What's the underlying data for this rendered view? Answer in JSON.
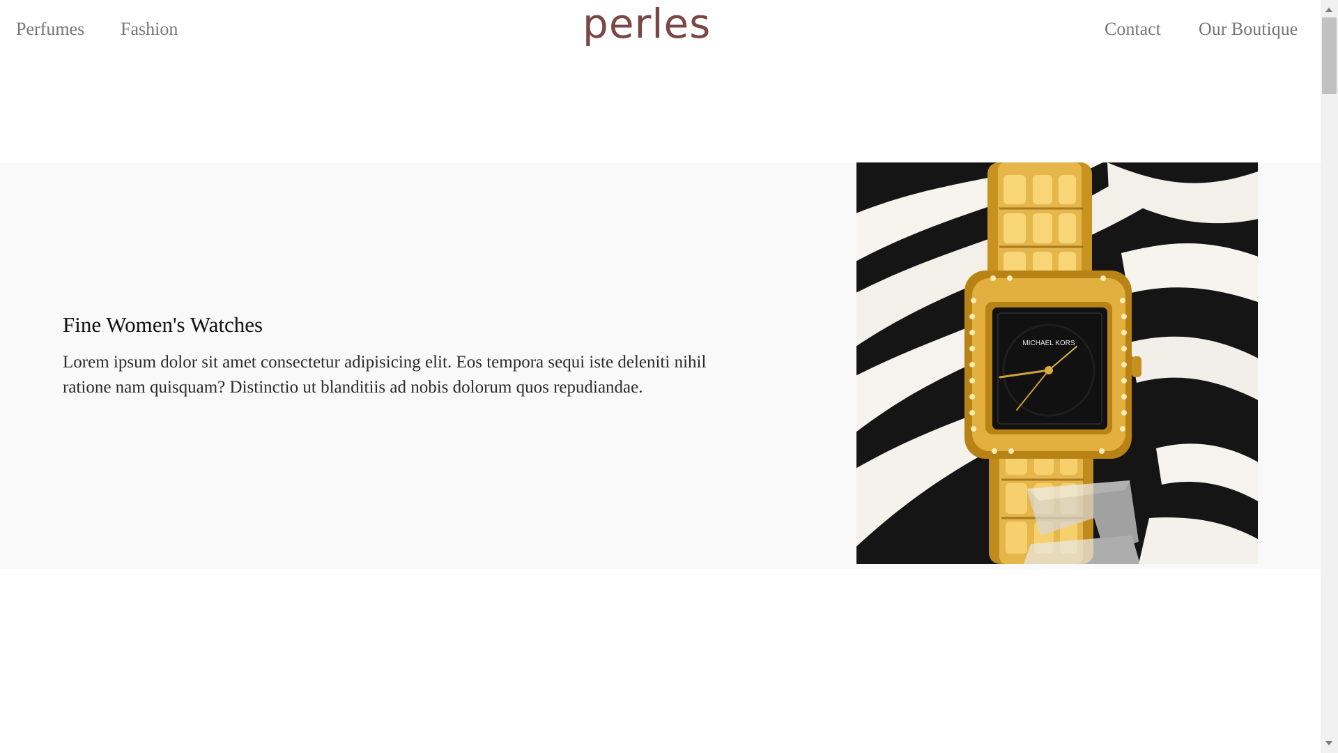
{
  "header": {
    "logo": "perles",
    "nav_left": [
      {
        "label": "Perfumes"
      },
      {
        "label": "Fashion"
      }
    ],
    "nav_right": [
      {
        "label": "Contact"
      },
      {
        "label": "Our Boutique"
      }
    ]
  },
  "feature": {
    "title": "Fine Women's Watches",
    "description": "Lorem ipsum dolor sit amet consectetur adipisicing elit. Eos tempora sequi iste deleniti nihil ratione nam quisquam? Distinctio ut blanditiis ad nobis dolorum quos repudiandae.",
    "image": {
      "dial_brand": "MICHAEL KORS",
      "icon": "watch-image"
    }
  },
  "colors": {
    "logo": "#7a4744",
    "nav_text": "#777777",
    "feature_background": "#f9f9f9",
    "watch_gold": "#d6a12e",
    "watch_dial": "#111111"
  }
}
